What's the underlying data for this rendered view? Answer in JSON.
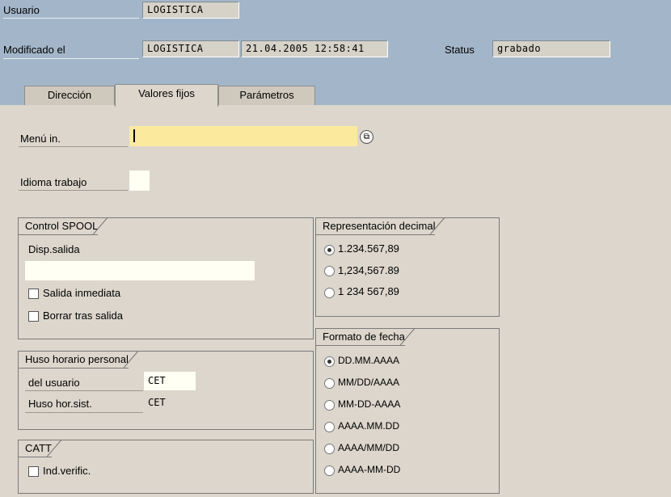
{
  "header": {
    "usuario_label": "Usuario",
    "usuario_value": "LOGISTICA",
    "modificado_label": "Modificado el",
    "modificado_user": "LOGISTICA",
    "modificado_datetime": "21.04.2005 12:58:41",
    "status_label": "Status",
    "status_value": "grabado"
  },
  "tabs": [
    {
      "label": "Dirección"
    },
    {
      "label": "Valores fijos"
    },
    {
      "label": "Parámetros"
    }
  ],
  "fields": {
    "menu_label": "Menú in.",
    "menu_value": "",
    "idioma_label": "Idioma trabajo",
    "idioma_value": ""
  },
  "spool": {
    "title": "Control SPOOL",
    "disp_label": "Disp.salida",
    "disp_value": "",
    "salida_inmediata": "Salida inmediata",
    "borrar_tras_salida": "Borrar tras salida"
  },
  "huso": {
    "title": "Huso horario personal",
    "usuario_label": "del usuario",
    "usuario_value": "CET",
    "sistema_label": "Huso hor.sist.",
    "sistema_value": "CET"
  },
  "catt": {
    "title": "CATT",
    "ind_verific": "Ind.verific."
  },
  "decimal": {
    "title": "Representación decimal",
    "options": [
      "1.234.567,89",
      "1,234,567.89",
      "1 234 567,89"
    ],
    "selected": 0
  },
  "fecha": {
    "title": "Formato de fecha",
    "options": [
      "DD.MM.AAAA",
      "MM/DD/AAAA",
      "MM-DD-AAAA",
      "AAAA.MM.DD",
      "AAAA/MM/DD",
      "AAAA-MM-DD"
    ],
    "selected": 0
  },
  "colors": {
    "header_bg": "#a3b6c9",
    "panel_bg": "#dcd6cc",
    "input_active": "#fbea9e"
  }
}
